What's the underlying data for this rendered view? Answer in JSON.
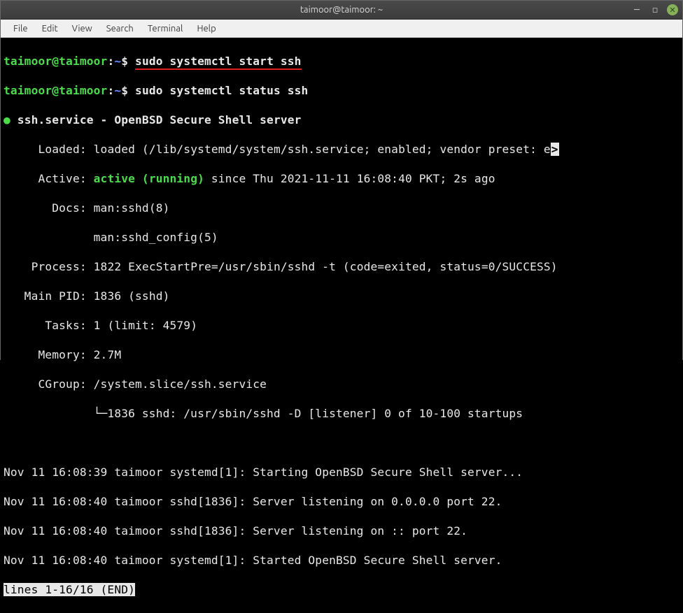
{
  "titlebar": {
    "title": "taimoor@taimoor: ~"
  },
  "menubar": {
    "file": "File",
    "edit": "Edit",
    "view": "View",
    "search": "Search",
    "terminal": "Terminal",
    "help": "Help"
  },
  "prompt": {
    "user_host": "taimoor@taimoor",
    "colon": ":",
    "cwd": "~",
    "dollar": "$ "
  },
  "commands": {
    "cmd1": "sudo systemctl start ssh",
    "cmd2": "sudo systemctl status ssh"
  },
  "status": {
    "bullet": "●",
    "unit_line": " ssh.service - OpenBSD Secure Shell server",
    "loaded_label": "     Loaded: ",
    "loaded_value": "loaded (/lib/systemd/system/ssh.service; enabled; vendor preset: e",
    "wrap_char": ">",
    "active_label": "     Active: ",
    "active_value": "active (running)",
    "active_since": " since Thu 2021-11-11 16:08:40 PKT; 2s ago",
    "docs_label": "       Docs: ",
    "docs1": "man:sshd(8)",
    "docs2": "             man:sshd_config(5)",
    "process_label": "    Process: ",
    "process_value": "1822 ExecStartPre=/usr/sbin/sshd -t (code=exited, status=0/SUCCESS)",
    "mainpid_label": "   Main PID: ",
    "mainpid_value": "1836 (sshd)",
    "tasks_label": "      Tasks: ",
    "tasks_value": "1 (limit: 4579)",
    "memory_label": "     Memory: ",
    "memory_value": "2.7M",
    "cgroup_label": "     CGroup: ",
    "cgroup_value": "/system.slice/ssh.service",
    "cgroup_tree": "             └─1836 sshd: /usr/sbin/sshd -D [listener] 0 of 10-100 startups"
  },
  "logs": {
    "l1": "Nov 11 16:08:39 taimoor systemd[1]: Starting OpenBSD Secure Shell server...",
    "l2": "Nov 11 16:08:40 taimoor sshd[1836]: Server listening on 0.0.0.0 port 22.",
    "l3": "Nov 11 16:08:40 taimoor sshd[1836]: Server listening on :: port 22.",
    "l4": "Nov 11 16:08:40 taimoor systemd[1]: Started OpenBSD Secure Shell server."
  },
  "pager": "lines 1-16/16 (END)"
}
